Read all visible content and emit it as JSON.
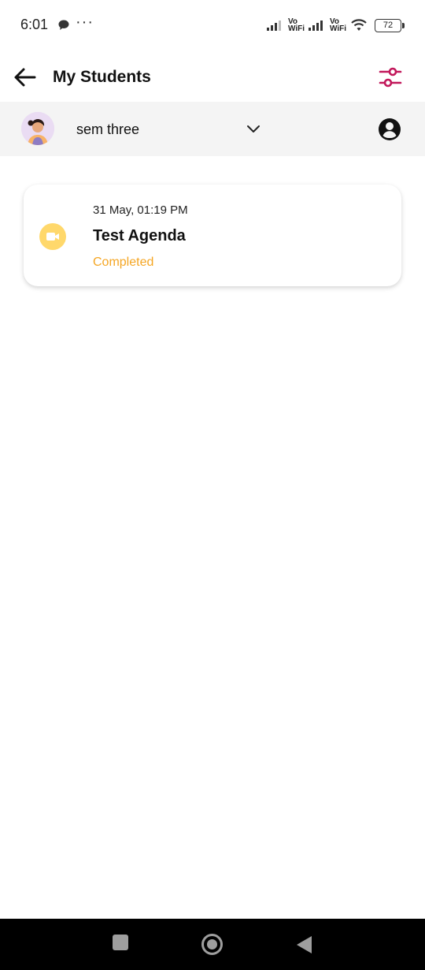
{
  "status_bar": {
    "time": "6:01",
    "dots": "···",
    "vowifi_top": "Vo",
    "vowifi_bottom": "WiFi",
    "battery": "72"
  },
  "app_bar": {
    "title": "My Students",
    "back_icon": "arrow-left-icon",
    "filter_icon": "sliders-icon",
    "accent_color": "#c2185b"
  },
  "selector": {
    "group_name": "sem three",
    "dropdown_icon": "chevron-down-icon",
    "profile_icon": "account-circle-icon"
  },
  "meetings": [
    {
      "date": "31 May, 01:19 PM",
      "title": "Test Agenda",
      "status": "Completed",
      "status_color": "#f5a623",
      "icon": "video-camera-icon"
    }
  ],
  "nav_bar": {
    "recent_icon": "square-icon",
    "home_icon": "circle-icon",
    "back_icon": "triangle-back-icon"
  }
}
